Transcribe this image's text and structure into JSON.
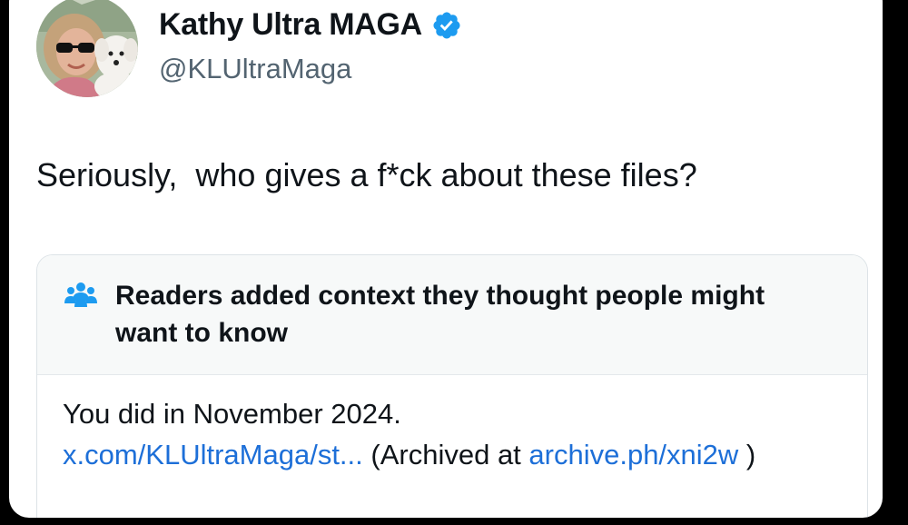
{
  "author": {
    "display_name": "Kathy Ultra MAGA",
    "handle": "@KLUltraMaga",
    "verified": true,
    "avatar_icon": "profile-photo-woman-with-white-dog"
  },
  "tweet": {
    "text": "Seriously,  who gives a f*ck about these files?"
  },
  "community_note": {
    "icon": "people-group-icon",
    "title": "Readers added context they thought people might want to know",
    "body_text": "You did in November 2024.",
    "link_1": "x.com/KLUltraMaga/st...",
    "archived_prefix": " (Archived at ",
    "link_2": "archive.ph/​xni2w",
    "archived_suffix": " )"
  },
  "colors": {
    "verified_badge": "#1d9bf0",
    "link": "#1d6fd8",
    "note_icon": "#1d9bf0",
    "background": "#000000",
    "card": "#ffffff"
  }
}
